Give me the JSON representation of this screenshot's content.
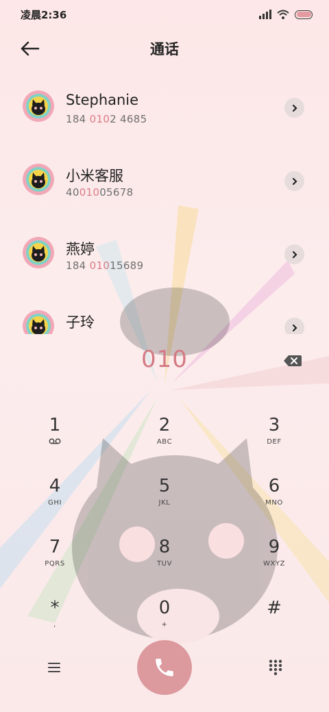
{
  "status_bar": {
    "time": "凌晨2:36",
    "icons": [
      "signal-icon",
      "wifi-icon",
      "battery-icon"
    ]
  },
  "header": {
    "title": "通话",
    "back_icon": "arrow-left-icon"
  },
  "contacts": [
    {
      "name": "Stephanie",
      "number_pre": "184 ",
      "number_match": "010",
      "number_post": "2 4685"
    },
    {
      "name": "小米客服",
      "number_pre": "40",
      "number_match": "010",
      "number_post": "05678"
    },
    {
      "name": "燕婷",
      "number_pre": "184 ",
      "number_match": "010",
      "number_post": "15689"
    },
    {
      "name": "子玲",
      "number_pre": "",
      "number_match": "",
      "number_post": ""
    }
  ],
  "dialer": {
    "dialed_number": "010",
    "keys": [
      {
        "digit": "1",
        "letters": ""
      },
      {
        "digit": "2",
        "letters": "ABC"
      },
      {
        "digit": "3",
        "letters": "DEF"
      },
      {
        "digit": "4",
        "letters": "GHI"
      },
      {
        "digit": "5",
        "letters": "JKL"
      },
      {
        "digit": "6",
        "letters": "MNO"
      },
      {
        "digit": "7",
        "letters": "PQRS"
      },
      {
        "digit": "8",
        "letters": "TUV"
      },
      {
        "digit": "9",
        "letters": "WXYZ"
      },
      {
        "digit": "*",
        "letters": ","
      },
      {
        "digit": "0",
        "letters": "+"
      },
      {
        "digit": "#",
        "letters": ""
      }
    ]
  },
  "colors": {
    "accent": "#d47a83",
    "call_button": "#dc9a9f",
    "chevron_bg": "#e6dcdc"
  }
}
